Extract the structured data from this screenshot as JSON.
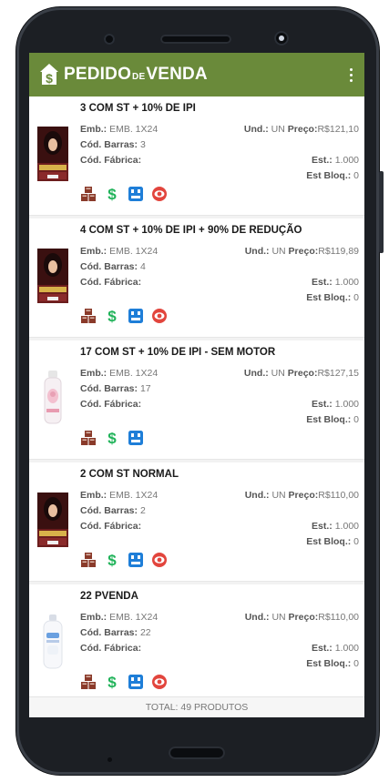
{
  "app": {
    "title_part1": "PEDIDO",
    "title_part2": "DE",
    "title_part3": "VENDA"
  },
  "products": [
    {
      "title": "3  COM ST + 10% DE IPI",
      "emb_label": "Emb.:",
      "emb": "EMB. 1X24",
      "und_label": "Und.:",
      "und": "UN",
      "preco_label": "Preço:",
      "preco": "R$121,10",
      "barras_label": "Cód. Barras:",
      "barras": "3",
      "fabrica_label": "Cód. Fábrica:",
      "est_label": "Est.:",
      "est": "1.000",
      "estbloq_label": "Est Bloq.:",
      "estbloq": "0",
      "thumb": "hair-dye-box-icon"
    },
    {
      "title": "4  COM ST + 10% DE IPI + 90% DE REDUÇÃO",
      "emb_label": "Emb.:",
      "emb": "EMB. 1X24",
      "und_label": "Und.:",
      "und": "UN",
      "preco_label": "Preço:",
      "preco": "R$119,89",
      "barras_label": "Cód. Barras:",
      "barras": "4",
      "fabrica_label": "Cód. Fábrica:",
      "est_label": "Est.:",
      "est": "1.000",
      "estbloq_label": "Est Bloq.:",
      "estbloq": "0",
      "thumb": "hair-dye-box-icon"
    },
    {
      "title": "17  COM ST + 10% DE IPI - SEM MOTOR",
      "emb_label": "Emb.:",
      "emb": "EMB. 1X24",
      "und_label": "Und.:",
      "und": "UN",
      "preco_label": "Preço:",
      "preco": "R$127,15",
      "barras_label": "Cód. Barras:",
      "barras": "17",
      "fabrica_label": "Cód. Fábrica:",
      "est_label": "Est.:",
      "est": "1.000",
      "estbloq_label": "Est Bloq.:",
      "estbloq": "0",
      "thumb": "lotion-bottle-icon"
    },
    {
      "title": "2  COM ST NORMAL",
      "emb_label": "Emb.:",
      "emb": "EMB. 1X24",
      "und_label": "Und.:",
      "und": "UN",
      "preco_label": "Preço:",
      "preco": "R$110,00",
      "barras_label": "Cód. Barras:",
      "barras": "2",
      "fabrica_label": "Cód. Fábrica:",
      "est_label": "Est.:",
      "est": "1.000",
      "estbloq_label": "Est Bloq.:",
      "estbloq": "0",
      "thumb": "hair-dye-box-icon"
    },
    {
      "title": "22  PVENDA",
      "emb_label": "Emb.:",
      "emb": "EMB. 1X24",
      "und_label": "Und.:",
      "und": "UN",
      "preco_label": "Preço:",
      "preco": "R$110,00",
      "barras_label": "Cód. Barras:",
      "barras": "22",
      "fabrica_label": "Cód. Fábrica:",
      "est_label": "Est.:",
      "est": "1.000",
      "estbloq_label": "Est Bloq.:",
      "estbloq": "0",
      "thumb": "baby-powder-bottle-icon"
    }
  ],
  "footer": {
    "total": "TOTAL: 49 PRODUTOS"
  },
  "colors": {
    "appbar": "#6a8a3a",
    "boxes_icon": "#8a3a2a",
    "dollar_icon": "#21b35a",
    "calc_icon": "#1e7ed8",
    "eye_icon": "#e2453d"
  }
}
